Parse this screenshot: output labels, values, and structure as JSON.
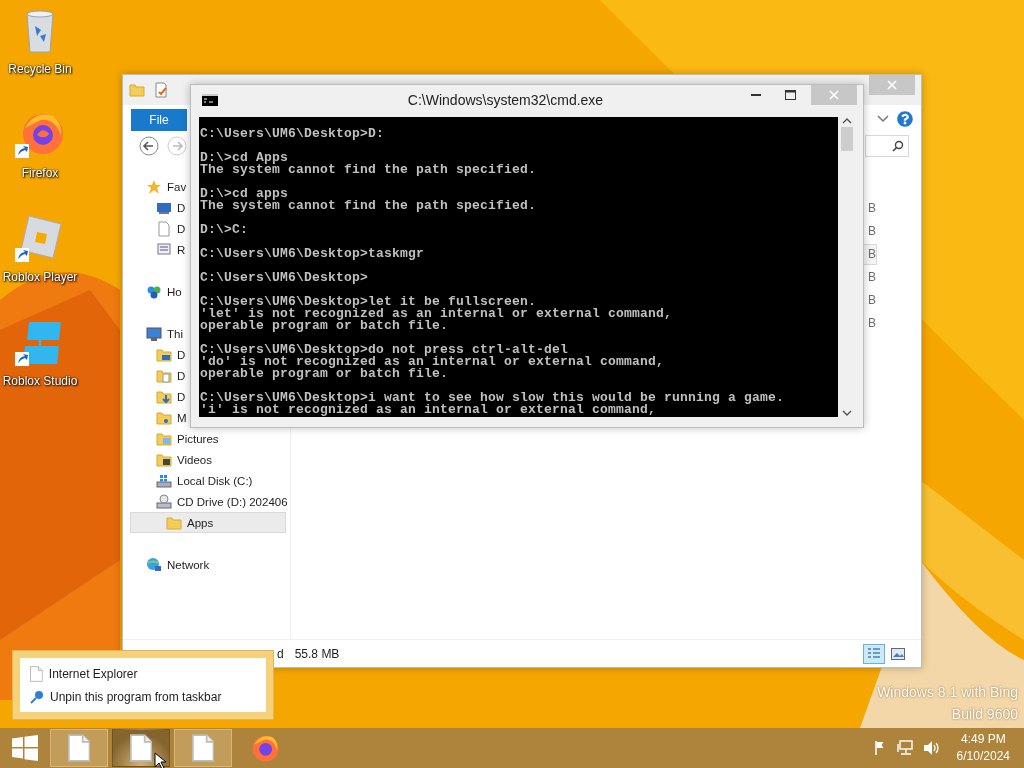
{
  "desktop": {
    "icons": [
      {
        "kind": "recycle-bin",
        "label": "Recycle Bin"
      },
      {
        "kind": "firefox",
        "label": "Firefox"
      },
      {
        "kind": "roblox-player",
        "label": "Roblox Player"
      },
      {
        "kind": "roblox-studio",
        "label": "Roblox Studio"
      }
    ],
    "os_notice": [
      "Windows 8.1 with Bing",
      "Build 9600"
    ]
  },
  "explorer": {
    "ribbon_tab": "File",
    "nav": [
      {
        "kind": "favorites",
        "label": "Fav",
        "selected": false,
        "children": [
          {
            "kind": "desktop",
            "label": "D",
            "selected": false
          },
          {
            "kind": "page",
            "label": "D",
            "selected": false
          },
          {
            "kind": "recent",
            "label": "R",
            "selected": false
          }
        ]
      },
      {
        "kind": "homegroup",
        "label": "Ho",
        "selected": false
      },
      {
        "kind": "pc",
        "label": "Thi",
        "selected": false,
        "children": [
          {
            "kind": "desktop-folder",
            "label": "D",
            "selected": false
          },
          {
            "kind": "documents",
            "label": "D",
            "selected": false
          },
          {
            "kind": "downloads",
            "label": "D",
            "selected": false
          },
          {
            "kind": "music",
            "label": "M",
            "selected": false
          },
          {
            "kind": "pictures",
            "label": "Pictures",
            "selected": false
          },
          {
            "kind": "videos",
            "label": "Videos",
            "selected": false
          },
          {
            "kind": "disk",
            "label": "Local Disk (C:)",
            "selected": false
          },
          {
            "kind": "cd",
            "label": "CD Drive (D:) 202406",
            "selected": false,
            "children": [
              {
                "kind": "folder",
                "label": "Apps",
                "selected": true
              }
            ]
          }
        ]
      },
      {
        "kind": "network",
        "label": "Network",
        "selected": false
      }
    ],
    "sizes": [
      {
        "text": "B",
        "selected": false
      },
      {
        "text": "B",
        "selected": false
      },
      {
        "text": "B",
        "selected": true
      },
      {
        "text": "B",
        "selected": false
      },
      {
        "text": "B",
        "selected": false
      },
      {
        "text": "B",
        "selected": false
      }
    ],
    "status": {
      "selection": "d",
      "size": "55.8 MB"
    },
    "views": [
      {
        "kind": "details",
        "selected": true
      },
      {
        "kind": "large-icons",
        "selected": false
      }
    ]
  },
  "cmd": {
    "title": "C:\\Windows\\system32\\cmd.exe",
    "blocks": [
      [
        "C:\\Users\\UM6\\Desktop>D:"
      ],
      [
        "D:\\>cd Apps",
        "The system cannot find the path specified."
      ],
      [
        "D:\\>cd apps",
        "The system cannot find the path specified."
      ],
      [
        "D:\\>C:"
      ],
      [
        "C:\\Users\\UM6\\Desktop>taskmgr"
      ],
      [
        "C:\\Users\\UM6\\Desktop>"
      ],
      [
        "C:\\Users\\UM6\\Desktop>let it be fullscreen.",
        "'let' is not recognized as an internal or external command,",
        "operable program or batch file."
      ],
      [
        "C:\\Users\\UM6\\Desktop>do not press ctrl-alt-del",
        "'do' is not recognized as an internal or external command,",
        "operable program or batch file."
      ],
      [
        "C:\\Users\\UM6\\Desktop>i want to see how slow this would be running a game.",
        "'i' is not recognized as an internal or external command,"
      ]
    ]
  },
  "jump_list": {
    "items": [
      {
        "kind": "page",
        "label": "Internet Explorer"
      },
      {
        "kind": "unpin",
        "label": "Unpin this program from taskbar"
      }
    ]
  },
  "taskbar": {
    "buttons": [
      {
        "kind": "page",
        "running": true,
        "hovered": false
      },
      {
        "kind": "page",
        "running": false,
        "hovered": true
      },
      {
        "kind": "page",
        "running": true,
        "hovered": false
      },
      {
        "kind": "firefox",
        "running": false,
        "hovered": false
      }
    ],
    "clock": {
      "time": "4:49 PM",
      "date": "6/10/2024"
    }
  }
}
